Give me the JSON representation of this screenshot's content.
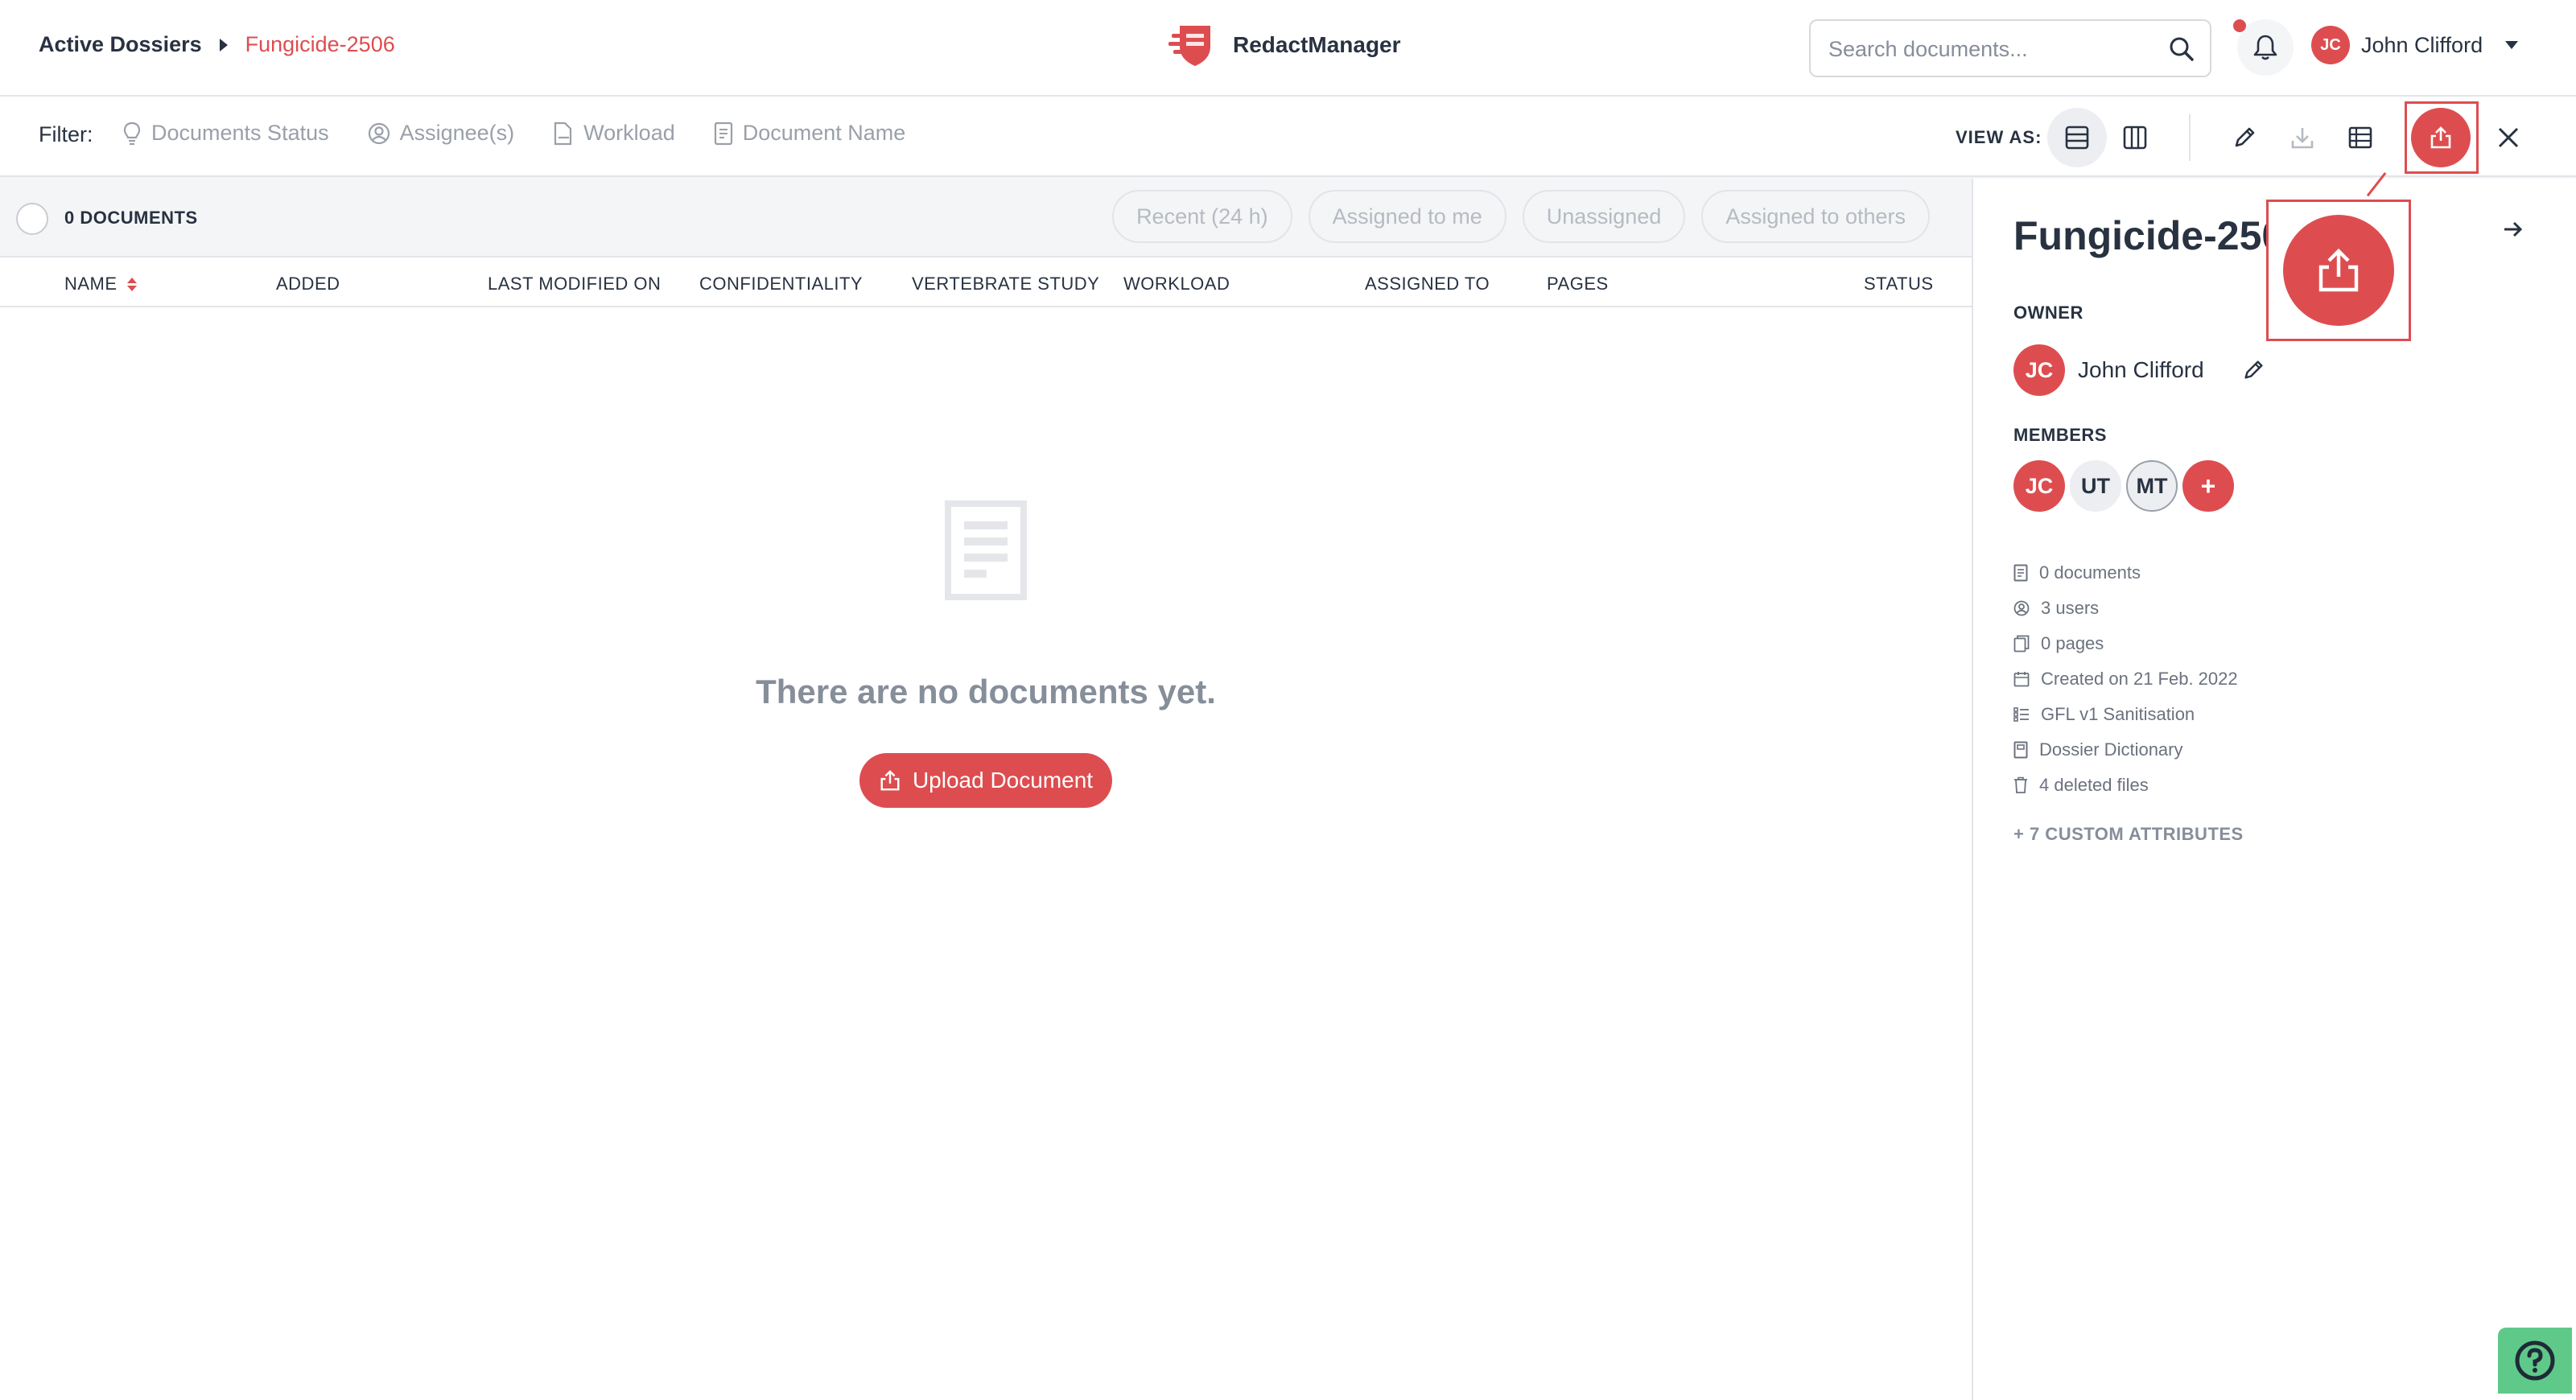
{
  "header": {
    "breadcrumb_root": "Active Dossiers",
    "breadcrumb_current": "Fungicide-2506",
    "brand_name": "RedactManager",
    "search_placeholder": "Search documents...",
    "user_initials": "JC",
    "user_name": "John Clifford"
  },
  "filterbar": {
    "label": "Filter:",
    "filters": [
      "Documents Status",
      "Assignee(s)",
      "Workload",
      "Document Name"
    ],
    "view_as_label": "VIEW AS:"
  },
  "list": {
    "document_count": "0 DOCUMENTS",
    "quick_filters": [
      "Recent (24 h)",
      "Assigned to me",
      "Unassigned",
      "Assigned to others"
    ],
    "columns": [
      "NAME",
      "ADDED",
      "LAST MODIFIED ON",
      "CONFIDENTIALITY",
      "VERTEBRATE STUDY",
      "WORKLOAD",
      "ASSIGNED TO",
      "PAGES",
      "STATUS"
    ],
    "empty_message": "There are no documents yet.",
    "upload_label": "Upload Document"
  },
  "sidepanel": {
    "title": "Fungicide-2506",
    "owner_label": "OWNER",
    "owner_initials": "JC",
    "owner_name": "John Clifford",
    "members_label": "MEMBERS",
    "members": [
      "JC",
      "UT",
      "MT"
    ],
    "add_member": "+",
    "stats": [
      "0 documents",
      "3 users",
      "0 pages",
      "Created on 21 Feb. 2022",
      "GFL v1 Sanitisation",
      "Dossier Dictionary",
      "4 deleted files"
    ],
    "custom_attributes": "+ 7 CUSTOM ATTRIBUTES"
  },
  "colors": {
    "accent": "#dd4d50",
    "text": "#283241",
    "muted": "#868e9a",
    "help": "#5fc98a"
  }
}
